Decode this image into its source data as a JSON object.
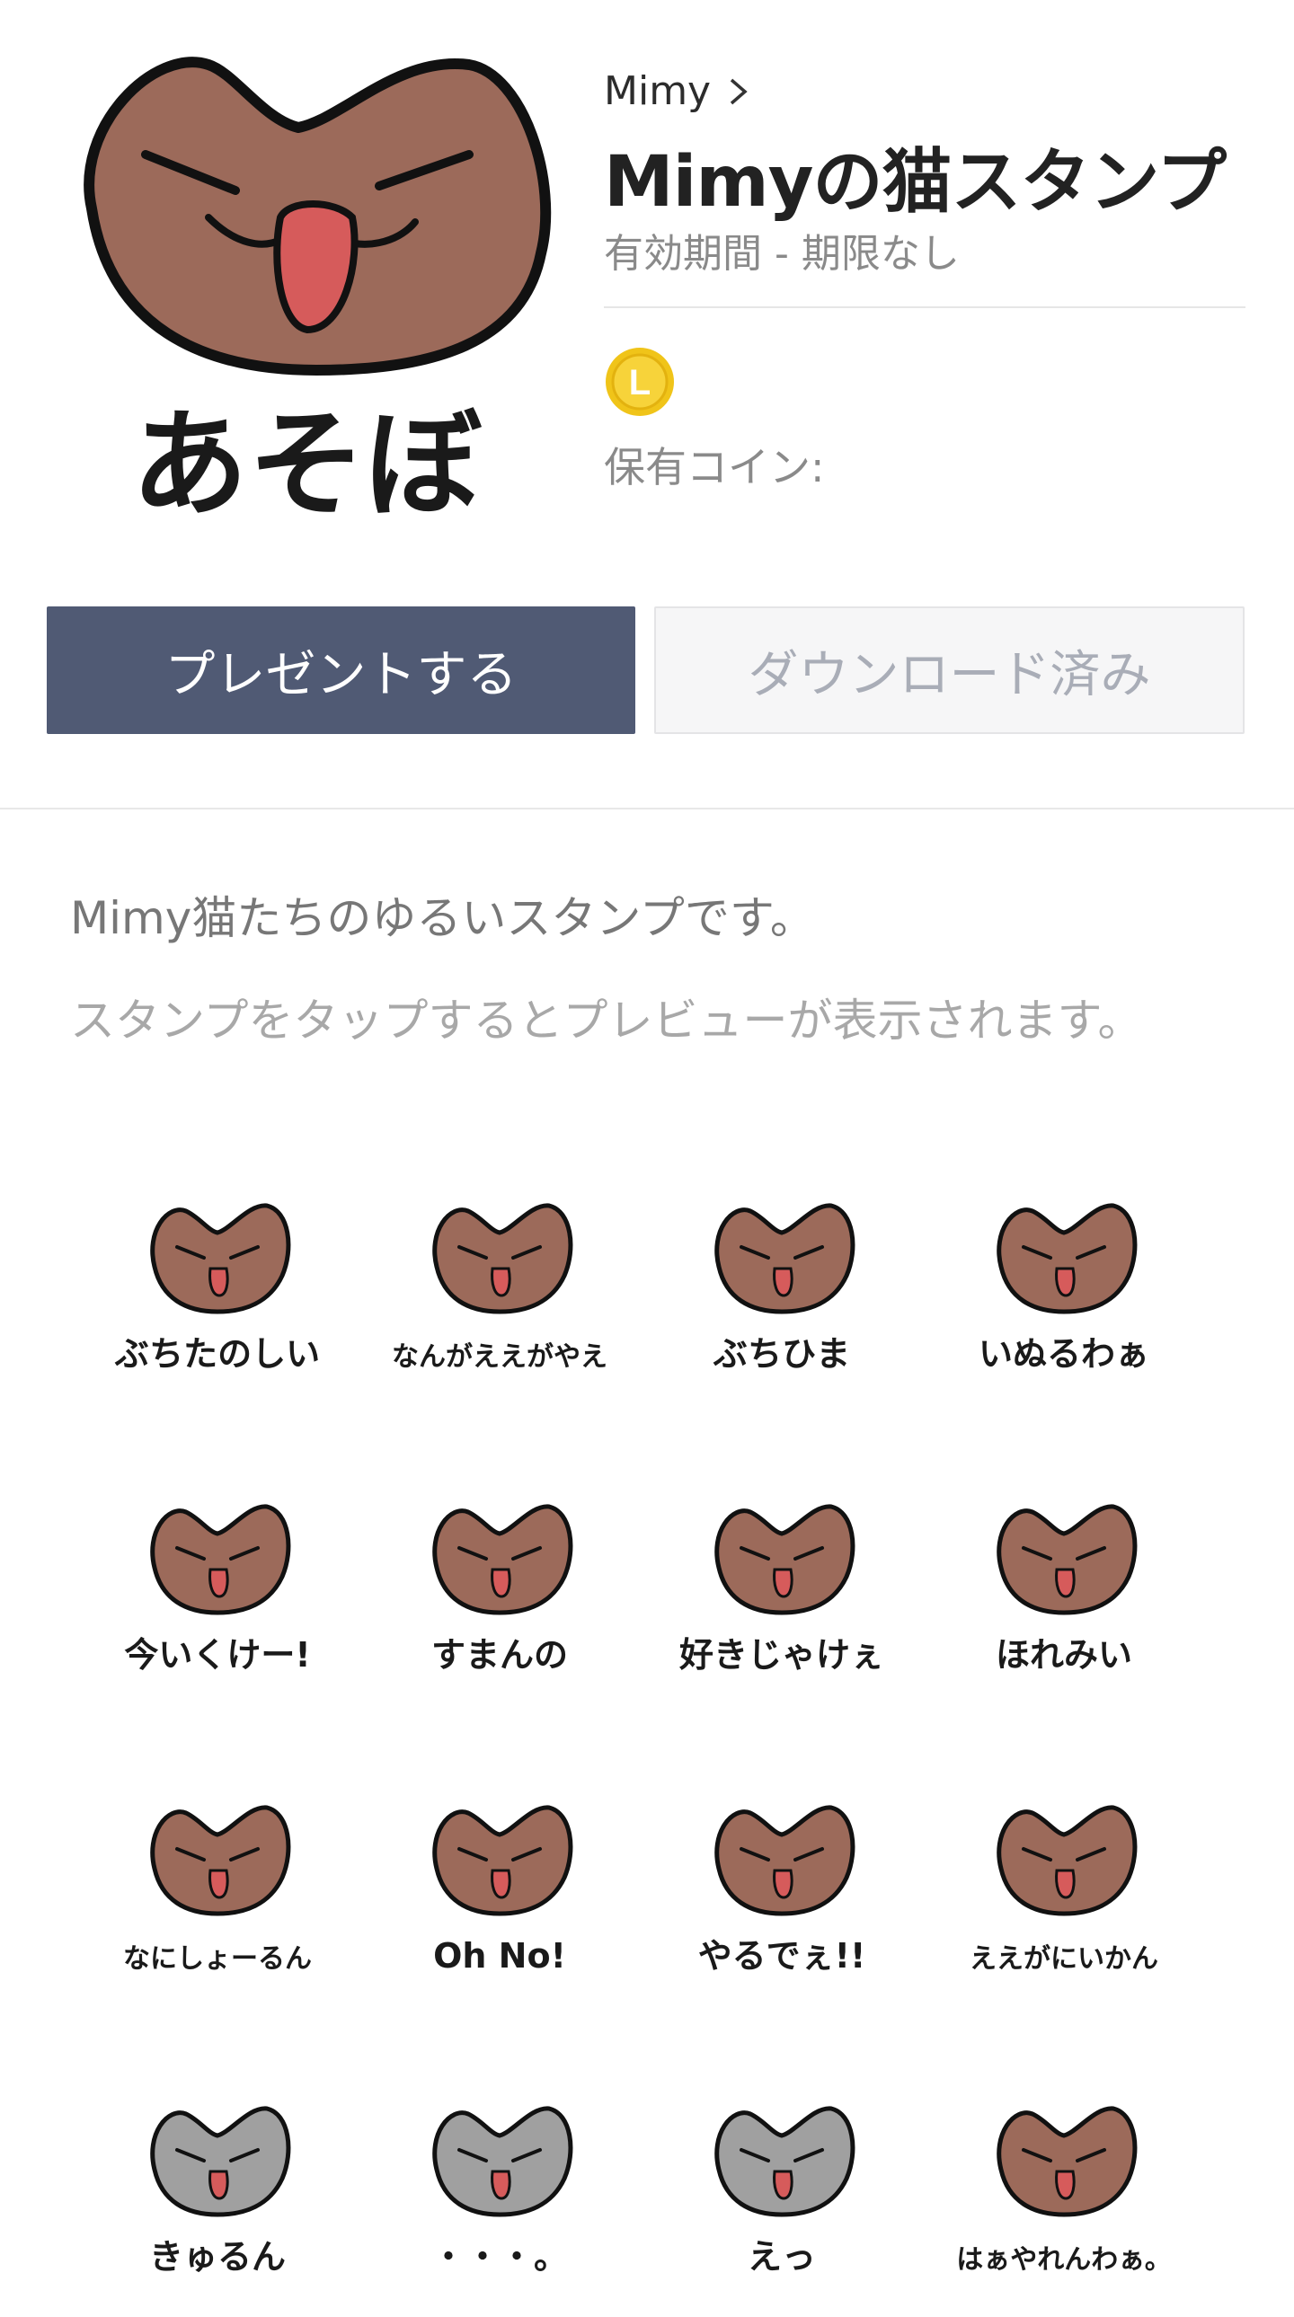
{
  "package": {
    "author": "Mimy",
    "title": "Mimyの猫スタンプ",
    "validity": "有効期間 - 期限なし",
    "coin_icon": "line-coin-icon",
    "coin_letter": "L",
    "owned_coins_label": "保有コイン:",
    "main_image_caption": "あそぼ",
    "colors": {
      "primary_button": "#505a74",
      "cat_brown": "#9c6a5a",
      "cat_gray": "#a0a0a0",
      "coin": "#f5c518"
    }
  },
  "actions": {
    "present_label": "プレゼントする",
    "download_label": "ダウンロード済み"
  },
  "description": {
    "text": "Mimy猫たちのゆるいスタンプです。",
    "hint": "スタンプをタップするとプレビューが表示されます。"
  },
  "stickers": [
    {
      "caption": "ぶちたのしい",
      "color": "brown"
    },
    {
      "caption": "なんがええがやえ",
      "color": "brown"
    },
    {
      "caption": "ぶちひま",
      "color": "brown"
    },
    {
      "caption": "いぬるわぁ",
      "color": "brown"
    },
    {
      "caption": "今いくけー!",
      "color": "brown"
    },
    {
      "caption": "すまんの",
      "color": "brown"
    },
    {
      "caption": "好きじゃけぇ",
      "color": "brown"
    },
    {
      "caption": "ほれみい",
      "color": "brown"
    },
    {
      "caption": "なにしょーるん",
      "color": "brown"
    },
    {
      "caption": "Oh No!",
      "color": "brown"
    },
    {
      "caption": "やるでぇ!!",
      "color": "brown"
    },
    {
      "caption": "ええがにいかん",
      "color": "brown"
    },
    {
      "caption": "きゅるん",
      "color": "gray"
    },
    {
      "caption": "・・・。",
      "color": "gray"
    },
    {
      "caption": "えっ",
      "color": "gray"
    },
    {
      "caption": "はぁやれんわぁ。",
      "color": "brown"
    }
  ]
}
